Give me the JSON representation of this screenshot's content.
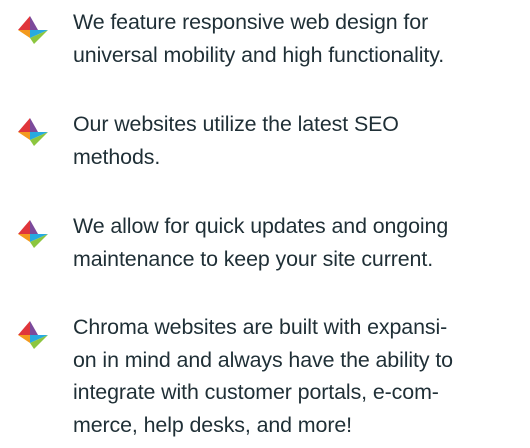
{
  "features": [
    {
      "icon": "chroma-arrow-icon",
      "lines": [
        "We feature responsive web design for",
        "universal mobility and high functionality."
      ]
    },
    {
      "icon": "chroma-arrow-icon",
      "lines": [
        "Our websites utilize the latest SEO",
        "methods."
      ]
    },
    {
      "icon": "chroma-arrow-icon",
      "lines": [
        "We allow for quick updates and ongoing",
        "maintenance to keep your site current."
      ]
    },
    {
      "icon": "chroma-arrow-icon",
      "lines": [
        "Chroma websites are built with expansi-",
        "on in mind and always have the ability to",
        "integrate with customer portals, e-com-",
        "merce, help desks, and more!"
      ]
    }
  ],
  "colors": {
    "text": "#1f2f36",
    "icon_red": "#e0353b",
    "icon_orange": "#f39a1e",
    "icon_green": "#8cc63f",
    "icon_purple": "#7c4a9b",
    "icon_blue": "#27aae1"
  }
}
